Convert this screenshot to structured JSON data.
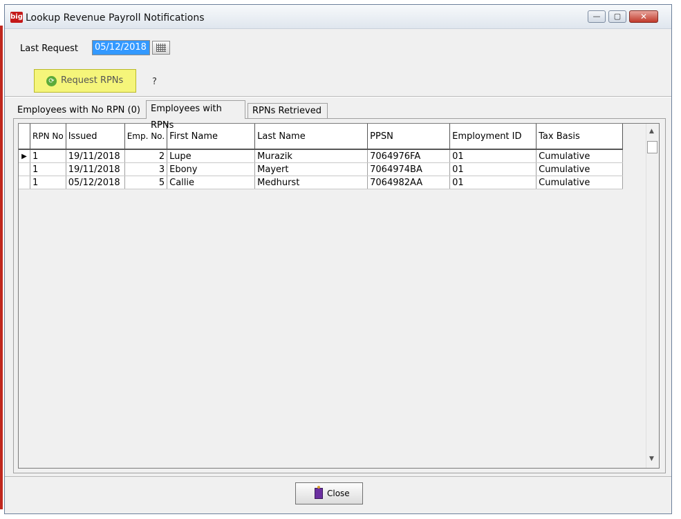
{
  "window": {
    "app_icon": "big",
    "title": "Lookup Revenue Payroll Notifications",
    "controls": {
      "minimize": "—",
      "maximize": "▢",
      "close": "✕"
    }
  },
  "request": {
    "last_request_label": "Last Request",
    "last_request_value": "05/12/2018",
    "request_button_label": "Request RPNs",
    "help_label": "?"
  },
  "tabs": [
    {
      "label": "Employees with No RPN (0)"
    },
    {
      "label": "Employees with RPNs",
      "active": true
    },
    {
      "label": "RPNs Retrieved"
    }
  ],
  "table": {
    "columns": [
      "RPN No",
      "Issued",
      "Emp. No.",
      "First Name",
      "Last Name",
      "PPSN",
      "Employment ID",
      "Tax Basis"
    ],
    "rows": [
      {
        "indicator": "▶",
        "rpn_no": "1",
        "issued": "19/11/2018",
        "emp_no": "2",
        "first_name": "Lupe",
        "last_name": "Murazik",
        "ppsn": "7064976FA",
        "employment_id": "01",
        "tax_basis": "Cumulative"
      },
      {
        "indicator": "",
        "rpn_no": "1",
        "issued": "19/11/2018",
        "emp_no": "3",
        "first_name": "Ebony",
        "last_name": "Mayert",
        "ppsn": "7064974BA",
        "employment_id": "01",
        "tax_basis": "Cumulative"
      },
      {
        "indicator": "",
        "rpn_no": "1",
        "issued": "05/12/2018",
        "emp_no": "5",
        "first_name": "Callie",
        "last_name": "Medhurst",
        "ppsn": "7064982AA",
        "employment_id": "01",
        "tax_basis": "Cumulative"
      }
    ]
  },
  "footer": {
    "close_label": "Close"
  },
  "colors": {
    "highlight_button": "#f5f57a",
    "selection": "#3399ff",
    "close_red": "#c0392b"
  }
}
